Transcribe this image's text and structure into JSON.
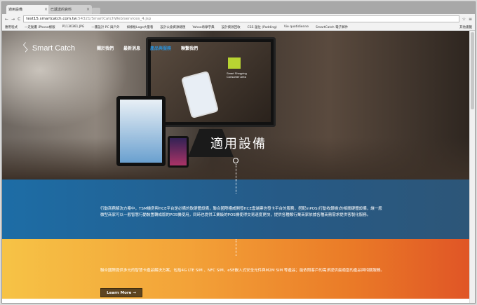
{
  "browser": {
    "tabs": [
      {
        "title": "適用設備",
        "active": true
      },
      {
        "title": "已遞送的資料",
        "active": false
      }
    ],
    "url_host": "test15.smartcatch.com.tw",
    "url_path": ":54321/SmartCatchWeb/services_4.jsp",
    "bookmarks": [
      "應用程式",
      "一走動畫 iPhone樣版",
      "P1130361.JPG",
      "一畫設計 PC 與戶外",
      "如樣板Logo大量看",
      "設計公會資源總匯",
      "Yahoo奇摩字典",
      "設計資源回收",
      "CSS 邊位 (Padding)",
      "Vie quotidienne",
      "SmartCatch 電子郵件",
      "其他書籤"
    ]
  },
  "site": {
    "logo": "Smart Catch",
    "nav": [
      "關於我們",
      "最新消息",
      "產品與服務",
      "聯繫我們"
    ],
    "active_nav": 2,
    "hero_title": "適用設備",
    "screen_text": "Smart Shopping Consumer Area",
    "blue_text": "行動商務解決方案中，TSM機房與HCE平台是必備的軟硬體設備，聯合國際權威開發HCE雲端票信發卡平台的服務，搭配mPOS(行動收銀機)的相關硬體設備，讓一般微型商家可以一般智慧行動裝置轉成版的POS機使用，同時也提供工業級的POS機使得交易速度更快，提供各種類行業商家依據各種商務需求提供客製化服務。",
    "orange_text": "聯合國際提供多元的智慧卡產品解決方案，包括4G LTE SIM 、NFC SIM、eSE嵌入式安全元件與M2M SIM 等產品；能依照客戶的需求提供最適當的產品與相關服務。",
    "learn_more": "Learn More →"
  },
  "colors": {
    "blue": "#1d6da6",
    "orange": "#f3a238",
    "button": "#5e4420",
    "nav_active": "#2a8fd6"
  }
}
